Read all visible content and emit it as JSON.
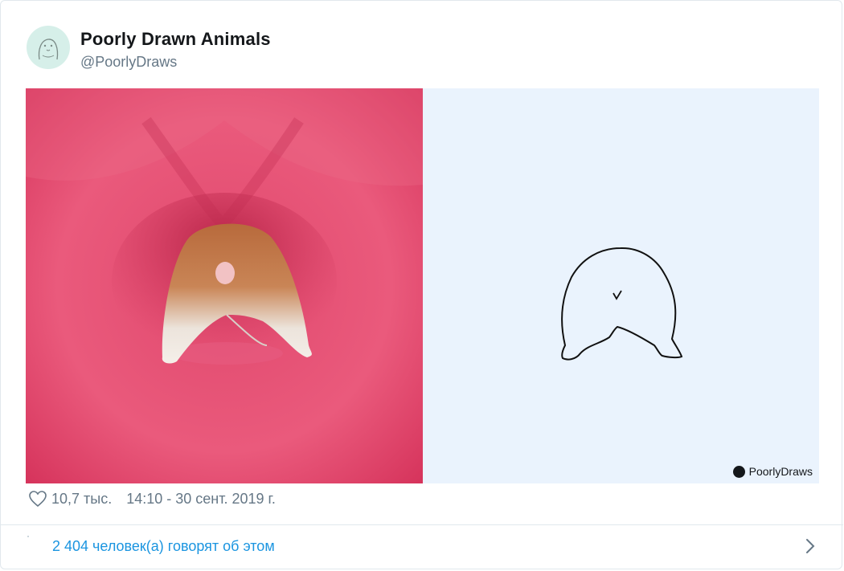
{
  "author": {
    "name": "Poorly Drawn Animals",
    "handle": "@PoorlyDraws"
  },
  "media": {
    "watermark": "PoorlyDraws",
    "photo_icon": "hamster-photo",
    "drawing_icon": "hamster-sketch"
  },
  "meta": {
    "likes": "10,7 тыс.",
    "timestamp": "14:10 - 30 сент. 2019 г."
  },
  "footer": {
    "talking": "2 404 человек(а) говорят об этом"
  },
  "colors": {
    "link": "#1b95e0",
    "muted": "#657786",
    "photo_bg": "#e2456c",
    "drawing_bg": "#eaf3fd"
  }
}
